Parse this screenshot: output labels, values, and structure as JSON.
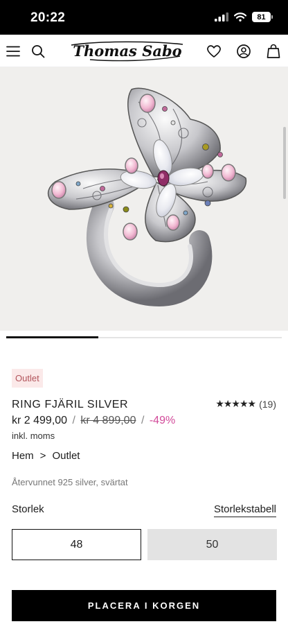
{
  "status_bar": {
    "time": "20:22",
    "battery": "81"
  },
  "header": {
    "brand": "Thomas Sabo",
    "icons": [
      "menu-icon",
      "search-icon",
      "heart-icon",
      "account-icon",
      "bag-icon"
    ]
  },
  "gallery": {
    "active_index": 1,
    "total": 3
  },
  "product": {
    "badge": "Outlet",
    "title": "RING FJÄRIL SILVER",
    "rating_stars": "★★★★★",
    "rating_count": "(19)",
    "price_current": "kr 2 499,00",
    "separator": "/",
    "price_original": "kr 4 899,00",
    "discount": "-49%",
    "vat_note": "inkl. moms",
    "material": "Återvunnet 925 silver, svärtat"
  },
  "breadcrumb": {
    "home": "Hem",
    "separator": ">",
    "category": "Outlet"
  },
  "size": {
    "label": "Storlek",
    "chart_link": "Storlekstabell",
    "options": [
      "48",
      "50"
    ],
    "selected": "48"
  },
  "cta": {
    "label": "PLACERA I KORGEN"
  },
  "colors": {
    "discount": "#d24b9a",
    "badge_bg": "#fbe9e9",
    "badge_text": "#b2545b",
    "cta_bg": "#000000"
  }
}
